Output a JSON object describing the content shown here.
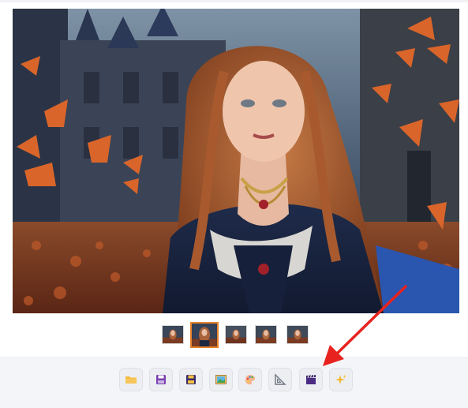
{
  "image": {
    "description_icon": "portrait-image"
  },
  "thumbnails": [
    {
      "name": "thumbnail-1",
      "selected": false
    },
    {
      "name": "thumbnail-2",
      "selected": true
    },
    {
      "name": "thumbnail-3",
      "selected": false
    },
    {
      "name": "thumbnail-4",
      "selected": false
    },
    {
      "name": "thumbnail-5",
      "selected": false
    }
  ],
  "toolbar": {
    "buttons": [
      {
        "icon": "folder-icon",
        "color": "#f4b93a"
      },
      {
        "icon": "save-icon",
        "color": "#7a3fb0"
      },
      {
        "icon": "save-as-icon",
        "color": "#5b2d8e"
      },
      {
        "icon": "image-icon",
        "color": "#3aa54a"
      },
      {
        "icon": "palette-icon",
        "color": "#f28a5b"
      },
      {
        "icon": "ruler-triangle-icon",
        "color": "#8a8f98"
      },
      {
        "icon": "clapperboard-icon",
        "color": "#4b2c84"
      },
      {
        "icon": "sparkles-icon",
        "color": "#f5b82e"
      }
    ]
  },
  "annotation": {
    "arrow_color": "#e8231f"
  }
}
